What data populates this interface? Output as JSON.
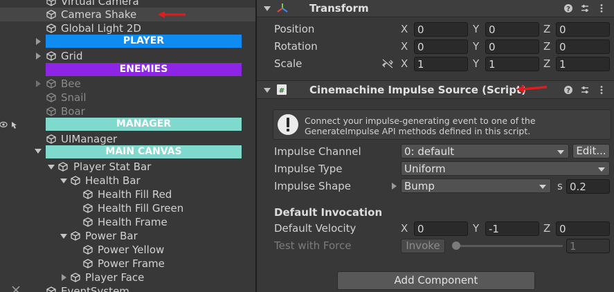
{
  "hierarchy": {
    "items": [
      {
        "label": "Virtual Camera"
      },
      {
        "label": "Camera Shake"
      },
      {
        "label": "Global Light 2D"
      },
      {
        "label": "Grid"
      },
      {
        "label": "Bee"
      },
      {
        "label": "Snail"
      },
      {
        "label": "Boar"
      },
      {
        "label": "UIManager"
      },
      {
        "label": "Player Stat Bar"
      },
      {
        "label": "Health Bar"
      },
      {
        "label": "Health Fill Red"
      },
      {
        "label": "Health Fill Green"
      },
      {
        "label": "Health Frame"
      },
      {
        "label": "Power Bar"
      },
      {
        "label": "Power Yellow"
      },
      {
        "label": "Power Frame"
      },
      {
        "label": "Player Face"
      },
      {
        "label": "EventSystem"
      }
    ],
    "bands": [
      {
        "label": "PLAYER",
        "color": "#0e8cf2"
      },
      {
        "label": "ENEMIES",
        "color": "#8e24e6"
      },
      {
        "label": "MANAGER",
        "color": "#7fd9cd"
      },
      {
        "label": "MAIN CANVAS",
        "color": "#7fd9cd"
      }
    ]
  },
  "inspector": {
    "transform": {
      "title": "Transform",
      "position": {
        "label": "Position",
        "x": "0",
        "y": "0",
        "z": "0"
      },
      "rotation": {
        "label": "Rotation",
        "x": "0",
        "y": "0",
        "z": "0"
      },
      "scale": {
        "label": "Scale",
        "x": "1",
        "y": "1",
        "z": "1"
      }
    },
    "impulse": {
      "title": "Cinemachine Impulse Source (Script)",
      "info_text": [
        "Connect your impulse-generating event to one of the",
        "GenerateImpulse API methods defined in this script."
      ],
      "channel_label": "Impulse Channel",
      "channel_value": "0: default",
      "edit_label": "Edit...",
      "type_label": "Impulse Type",
      "type_value": "Uniform",
      "shape_label": "Impulse Shape",
      "shape_value": "Bump",
      "shape_s_label": "s",
      "shape_s_value": "0.2",
      "section_label": "Default Invocation",
      "velocity_label": "Default Velocity",
      "velocity": {
        "x": "0",
        "y": "-1",
        "z": "0"
      },
      "test_label": "Test with Force",
      "invoke_label": "Invoke",
      "force_value": "1",
      "force_fraction": 0.0
    },
    "axes": {
      "x": "X",
      "y": "Y",
      "z": "Z"
    },
    "add_component_label": "Add Component"
  }
}
